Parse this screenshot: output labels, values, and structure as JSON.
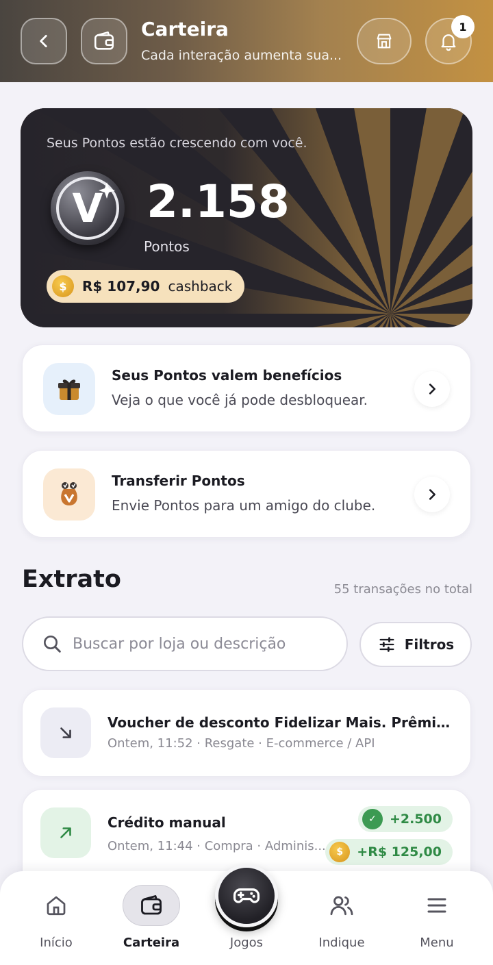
{
  "header": {
    "title": "Carteira",
    "subtitle": "Cada interação aumenta sua...",
    "notification_count": "1"
  },
  "points_card": {
    "label": "Seus Pontos estão crescendo com você.",
    "value": "2.158",
    "unit": "Pontos",
    "cashback_amount": "R$ 107,90",
    "cashback_label": "cashback",
    "coin_symbol": "$",
    "logo_letter": "V"
  },
  "actions": [
    {
      "title": "Seus Pontos valem benefícios",
      "desc": "Veja o que você já pode desbloquear.",
      "icon": "gift-icon"
    },
    {
      "title": "Transferir Pontos",
      "desc": "Envie Pontos para um amigo do clube.",
      "icon": "money-bag-icon"
    }
  ],
  "statement": {
    "title": "Extrato",
    "count": "55 transações no total",
    "search_placeholder": "Buscar por loja ou descrição",
    "filters_label": "Filtros",
    "transactions": [
      {
        "title": "Voucher de desconto Fidelizar Mais. Prêmio: C...",
        "meta": "Ontem, 11:52 · Resgate · E-commerce / API",
        "direction": "out"
      },
      {
        "title": "Crédito manual",
        "meta": "Ontem, 11:44 · Compra · Adminis...",
        "direction": "in",
        "points_amount": "+2.500",
        "cash_amount": "+R$ 125,00"
      }
    ]
  },
  "nav": {
    "items": [
      {
        "label": "Início",
        "icon": "home-icon"
      },
      {
        "label": "Carteira",
        "icon": "wallet-icon",
        "active": true
      },
      {
        "label": "Jogos",
        "icon": "gamepad-icon"
      },
      {
        "label": "Indique",
        "icon": "users-icon"
      },
      {
        "label": "Menu",
        "icon": "menu-icon"
      }
    ]
  },
  "colors": {
    "accent_gold": "#c39142",
    "card_dark": "#26242b",
    "positive_green": "#2f8a45",
    "cashback_pill": "#f6e1bc"
  }
}
